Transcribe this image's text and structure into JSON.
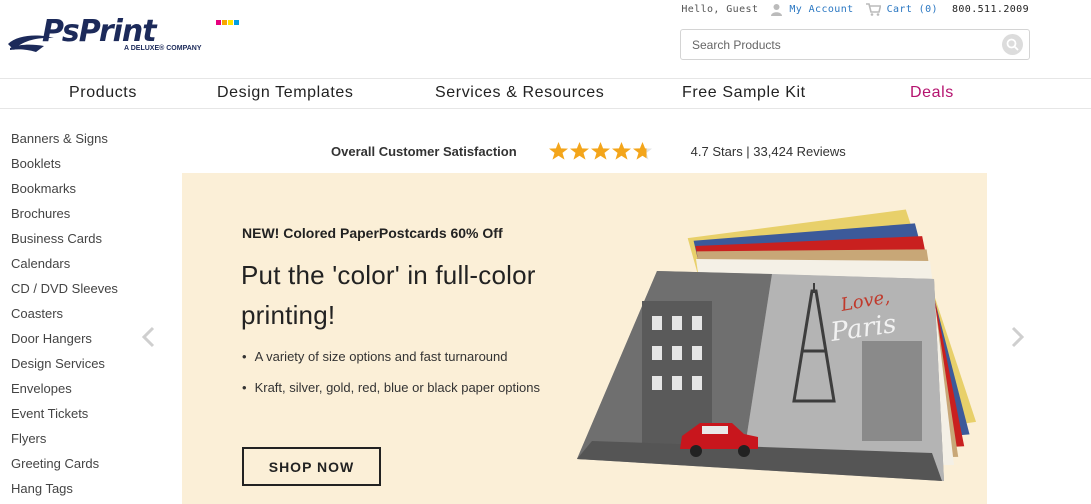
{
  "logo": {
    "name": "PsPrint",
    "tagline": "A DELUXE® COMPANY",
    "cmyk": [
      "#e6007e",
      "#f7a600",
      "#ffe500",
      "#009fe3"
    ]
  },
  "topbar": {
    "greeting": "Hello, Guest",
    "account_label": "My Account",
    "cart_label": "Cart (0)",
    "phone": "800.511.2009",
    "user_icon": "user-icon",
    "cart_icon": "cart-icon"
  },
  "search": {
    "placeholder": "Search Products",
    "value": "",
    "icon": "search-icon"
  },
  "nav": {
    "items": [
      {
        "label": "Products"
      },
      {
        "label": "Design Templates"
      },
      {
        "label": "Services & Resources"
      },
      {
        "label": "Free Sample Kit"
      },
      {
        "label": "Deals"
      }
    ],
    "deals_color": "#b5136f"
  },
  "sidebar": {
    "items": [
      "Banners & Signs",
      "Booklets",
      "Bookmarks",
      "Brochures",
      "Business Cards",
      "Calendars",
      "CD / DVD Sleeves",
      "Coasters",
      "Door Hangers",
      "Design Services",
      "Envelopes",
      "Event Tickets",
      "Flyers",
      "Greeting Cards",
      "Hang Tags"
    ]
  },
  "rating": {
    "label": "Overall Customer Satisfaction",
    "stars": 4.7,
    "max_stars": 5,
    "score_text": "4.7 Stars | 33,424 Reviews",
    "star_color": "#f3a51b"
  },
  "hero": {
    "tag": "NEW! Colored PaperPostcards 60% Off",
    "title": "Put the 'color' in full-color printing!",
    "bullets": [
      "A variety of size options and fast turnaround",
      "Kraft, silver, gold, red, blue or black paper options"
    ],
    "button": "SHOP NOW",
    "postcard_script_1": "Love,",
    "postcard_script_2": "Paris",
    "background": "#fbefd7"
  },
  "carousel": {
    "prev_icon": "chevron-left-icon",
    "next_icon": "chevron-right-icon"
  }
}
